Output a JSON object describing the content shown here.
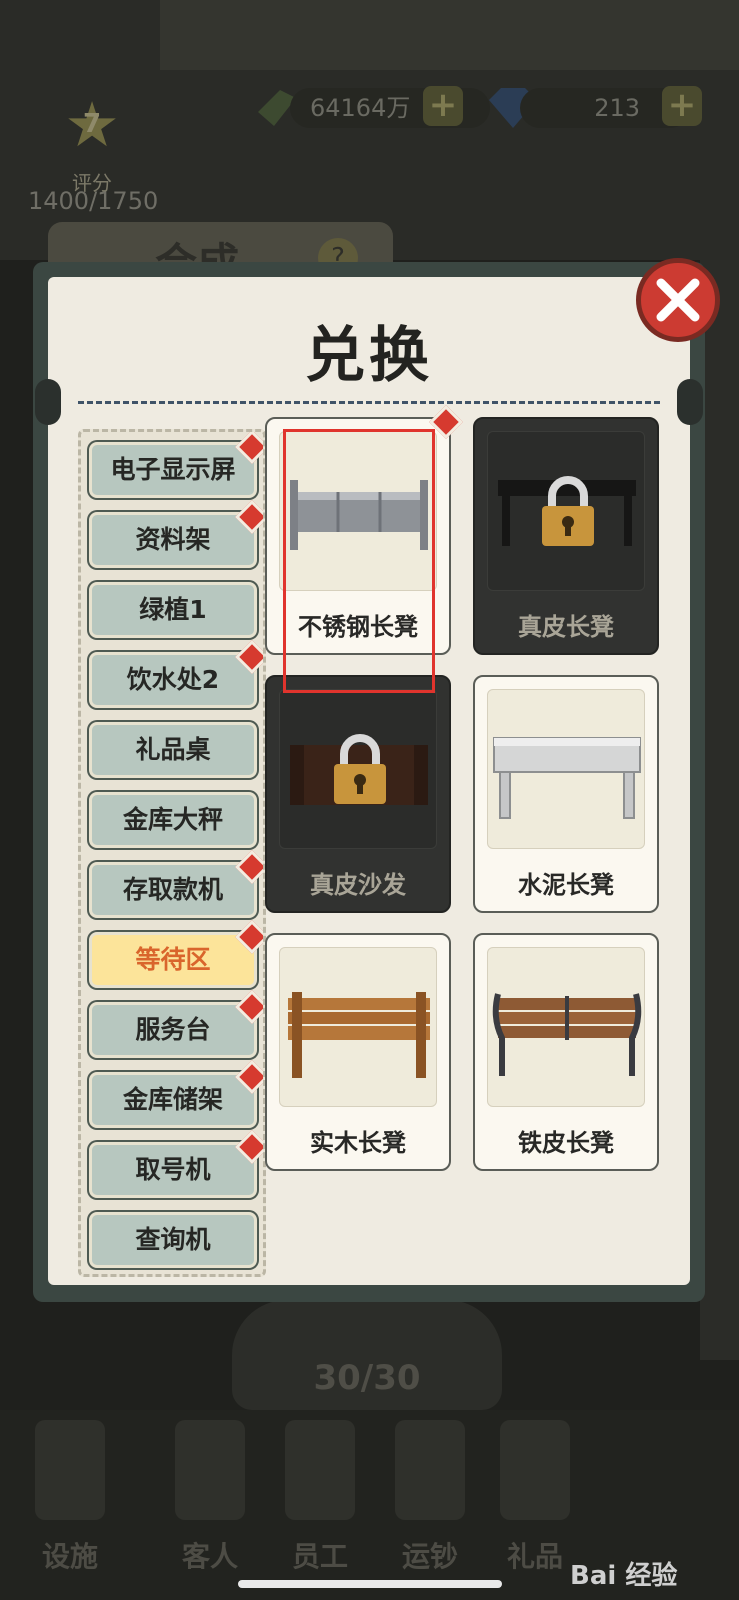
{
  "hud": {
    "rank_level": "7",
    "rank_label": "评分",
    "rank_score": "1400/1750",
    "money": "64164万",
    "gems": "213",
    "plus": "+",
    "behind_title": "合成",
    "behind_help": "?"
  },
  "modal": {
    "title": "兑换"
  },
  "sidebar": {
    "items": [
      {
        "label": "电子显示屏",
        "dot": true,
        "selected": false
      },
      {
        "label": "资料架",
        "dot": true,
        "selected": false
      },
      {
        "label": "绿植1",
        "dot": false,
        "selected": false
      },
      {
        "label": "饮水处2",
        "dot": true,
        "selected": false
      },
      {
        "label": "礼品桌",
        "dot": false,
        "selected": false
      },
      {
        "label": "金库大秤",
        "dot": false,
        "selected": false
      },
      {
        "label": "存取款机",
        "dot": true,
        "selected": false
      },
      {
        "label": "等待区",
        "dot": true,
        "selected": true
      },
      {
        "label": "服务台",
        "dot": true,
        "selected": false
      },
      {
        "label": "金库储架",
        "dot": true,
        "selected": false
      },
      {
        "label": "取号机",
        "dot": true,
        "selected": false
      },
      {
        "label": "查询机",
        "dot": false,
        "selected": false
      }
    ]
  },
  "cards": [
    {
      "label": "不锈钢长凳",
      "locked": false,
      "dot": true
    },
    {
      "label": "真皮长凳",
      "locked": true,
      "dot": false
    },
    {
      "label": "真皮沙发",
      "locked": true,
      "dot": false
    },
    {
      "label": "水泥长凳",
      "locked": false,
      "dot": false
    },
    {
      "label": "实木长凳",
      "locked": false,
      "dot": false
    },
    {
      "label": "铁皮长凳",
      "locked": false,
      "dot": false
    }
  ],
  "counter": "30/30",
  "bottom_nav": [
    {
      "label": "设施"
    },
    {
      "label": "客人"
    },
    {
      "label": "员工"
    },
    {
      "label": "运钞"
    },
    {
      "label": "礼品"
    }
  ],
  "watermark": "Bai 经验",
  "colors": {
    "selected_bg": "#fce49a",
    "selected_text": "#d9652c",
    "highlight": "#e0342d",
    "close_red": "#cc3b32",
    "dot_red": "#d63a2f"
  }
}
